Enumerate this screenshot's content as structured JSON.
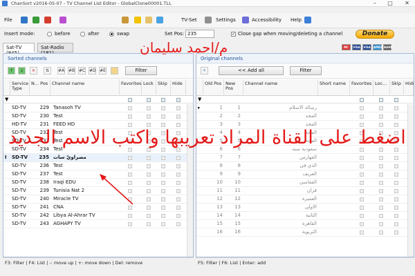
{
  "window": {
    "title": "ChanSort v2016-05-07 - TV Channel List Editor - GlobalClone00001.TLL",
    "min": "–",
    "max": "□",
    "close": "✕"
  },
  "menu": {
    "file": "File",
    "tvset": "TV-Set",
    "settings": "Settings",
    "accessibility": "Accessibility",
    "help": "Help"
  },
  "options": {
    "insert_mode_label": "Insert mode:",
    "before": "before",
    "after": "after",
    "swap": "swap",
    "setpos_label": "Set Pos:",
    "setpos_value": "235",
    "close_gap_label": "Close gap when moving/deleting a channel",
    "donate": "Donate"
  },
  "cards": [
    "MC",
    "VISA",
    "VISA",
    "AMEX",
    "BANK"
  ],
  "tabs": [
    "Sat-TV (845)",
    "Sat-Radio (181)"
  ],
  "left": {
    "title": "Sorted channels",
    "sort_buttons": [
      "#A",
      "#B",
      "#C",
      "#D",
      "#E"
    ],
    "filter": "Filter",
    "headers": [
      "Service Type",
      "N... Pos",
      "Channel name",
      "Favorites",
      "Lock",
      "Skip",
      "Hide"
    ],
    "rows": [
      {
        "type": "SD-TV",
        "pos": "229",
        "name": "Tanasoh TV"
      },
      {
        "type": "SD-TV",
        "pos": "230",
        "name": "Test"
      },
      {
        "type": "HD-TV",
        "pos": "231",
        "name": "FEED HD"
      },
      {
        "type": "SD-TV",
        "pos": "232",
        "name": "Test"
      },
      {
        "type": "SD-TV",
        "pos": "233",
        "name": "Test"
      },
      {
        "type": "SD-TV",
        "pos": "234",
        "name": "Test"
      },
      {
        "type": "SD-TV",
        "pos": "235",
        "name": "مصراويّ سات",
        "sel": true
      },
      {
        "type": "SD-TV",
        "pos": "236",
        "name": "Test"
      },
      {
        "type": "SD-TV",
        "pos": "237",
        "name": "Test"
      },
      {
        "type": "SD-TV",
        "pos": "238",
        "name": "Iraqi EDU"
      },
      {
        "type": "SD-TV",
        "pos": "239",
        "name": "Tunisia Nat 2"
      },
      {
        "type": "SD-TV",
        "pos": "240",
        "name": "Miracle TV"
      },
      {
        "type": "SD-TV",
        "pos": "241",
        "name": "CNA"
      },
      {
        "type": "SD-TV",
        "pos": "242",
        "name": "Libya Al-Ahrar TV"
      },
      {
        "type": "SD-TV",
        "pos": "243",
        "name": "AGHAPY TV"
      }
    ],
    "status": "F3: Filter | F4: List | -: move up | +: move down | Del: remove"
  },
  "right": {
    "title": "Original channels",
    "add_all": "<< Add all",
    "filter": "Filter",
    "headers": [
      "Old Pos",
      "New Pos",
      "Channel name",
      "Short name",
      "Favorites",
      "Loc...",
      "Skip",
      "Hide"
    ],
    "rows": [
      {
        "old": "1",
        "new": "1",
        "name": "رسالة الاسلام"
      },
      {
        "old": "2",
        "new": "2",
        "name": "المجد"
      },
      {
        "old": "3",
        "new": "3",
        "name": "المجد"
      },
      {
        "old": "4",
        "new": "4",
        "name": "المجد"
      },
      {
        "old": "5",
        "new": "5",
        "name": "المجد"
      },
      {
        "old": "6",
        "new": "6",
        "name": "سعودية سنه"
      },
      {
        "old": "7",
        "new": "7",
        "name": "الفهارس"
      },
      {
        "old": "8",
        "new": "8",
        "name": "الذي في"
      },
      {
        "old": "9",
        "new": "9",
        "name": "العريف"
      },
      {
        "old": "10",
        "new": "10",
        "name": "الفقاسي"
      },
      {
        "old": "11",
        "new": "11",
        "name": "قران"
      },
      {
        "old": "12",
        "new": "12",
        "name": "العميرة"
      },
      {
        "old": "13",
        "new": "13",
        "name": "الاولى"
      },
      {
        "old": "14",
        "new": "14",
        "name": "الثانية"
      },
      {
        "old": "15",
        "new": "15",
        "name": "القاهرة"
      },
      {
        "old": "16",
        "new": "16",
        "name": "التربوية"
      }
    ],
    "status": "F5: Filter | F6: List | Enter: add"
  },
  "overlay": {
    "name": "م/احمد سليمان",
    "instruction": "اضغط على القناة المراد تعريبها واكتب الاسم الجديد",
    "color": "#e41a1a"
  }
}
